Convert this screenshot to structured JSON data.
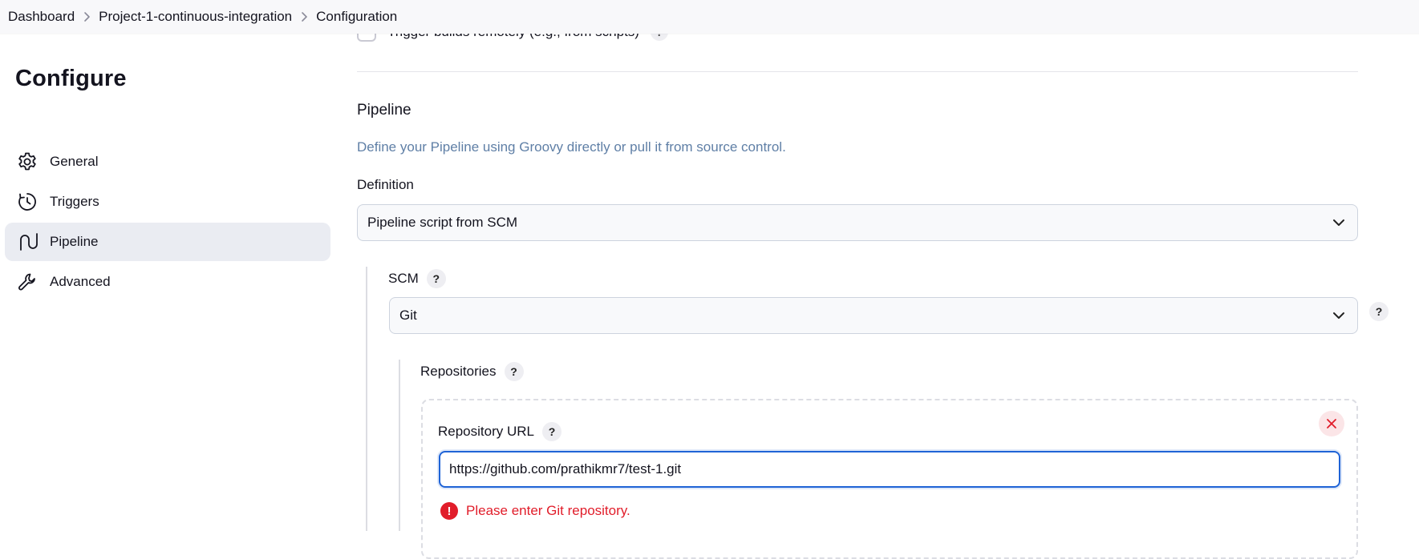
{
  "breadcrumb": {
    "items": [
      "Dashboard",
      "Project-1-continuous-integration",
      "Configuration"
    ]
  },
  "sidebar": {
    "title": "Configure",
    "items": [
      {
        "label": "General",
        "icon": "gear-icon"
      },
      {
        "label": "Triggers",
        "icon": "clock-icon"
      },
      {
        "label": "Pipeline",
        "icon": "pipeline-icon",
        "active": true
      },
      {
        "label": "Advanced",
        "icon": "wrench-icon"
      }
    ]
  },
  "triggers": {
    "remote_label": "Trigger builds remotely (e.g., from scripts)",
    "help": "?"
  },
  "pipeline": {
    "title": "Pipeline",
    "description": "Define your Pipeline using Groovy directly or pull it from source control.",
    "definition_label": "Definition",
    "definition_value": "Pipeline script from SCM",
    "scm_label": "SCM",
    "scm_value": "Git",
    "help": "?",
    "repositories_label": "Repositories",
    "repo_url_label": "Repository URL",
    "repo_url_value": "https://github.com/prathikmr7/test-1.git",
    "error_icon": "!",
    "error_message": "Please enter Git repository."
  },
  "colors": {
    "accent": "#1f63d6",
    "error": "#e11d2a",
    "description": "#5f7fa6",
    "active_nav_bg": "#eaecf2"
  }
}
